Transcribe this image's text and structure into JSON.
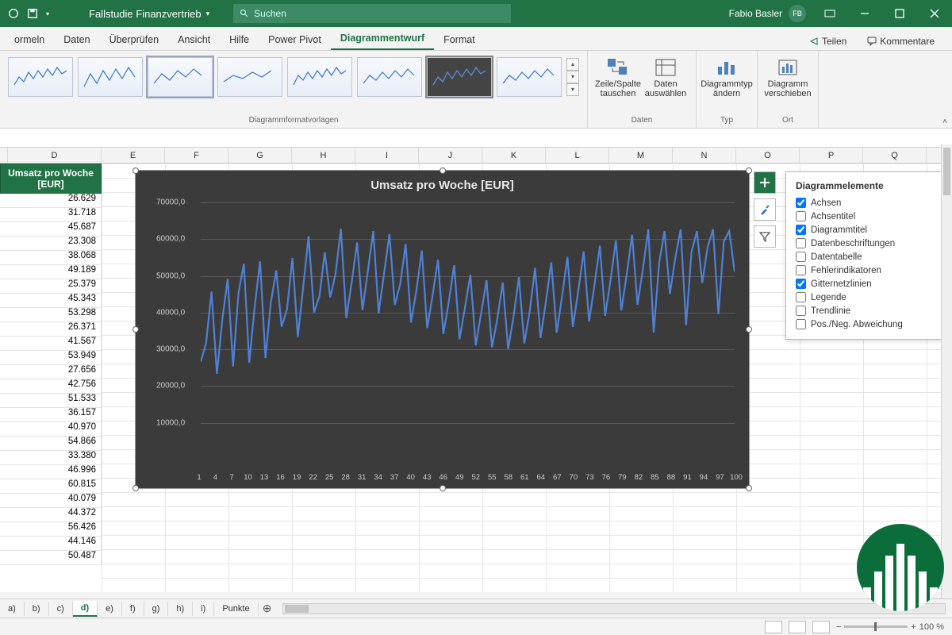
{
  "titlebar": {
    "filename": "Fallstudie Finanzvertrieb",
    "search_placeholder": "Suchen",
    "user_name": "Fabio Basler",
    "user_initials": "FB"
  },
  "ribbon_tabs": [
    "ormeln",
    "Daten",
    "Überprüfen",
    "Ansicht",
    "Hilfe",
    "Power Pivot",
    "Diagrammentwurf",
    "Format"
  ],
  "ribbon_active_tab": "Diagrammentwurf",
  "ribbon_right": {
    "share": "Teilen",
    "comments": "Kommentare"
  },
  "ribbon_groups": {
    "styles": "Diagrammformatvorlagen",
    "data": "Daten",
    "type": "Typ",
    "location": "Ort",
    "btn_switch": "Zeile/Spalte tauschen",
    "btn_select": "Daten auswählen",
    "btn_change": "Diagrammtyp ändern",
    "btn_move": "Diagramm verschieben"
  },
  "columns": [
    "D",
    "E",
    "F",
    "G",
    "H",
    "I",
    "J",
    "K",
    "L",
    "M",
    "N",
    "O",
    "P",
    "Q"
  ],
  "data_header": "Umsatz pro Woche [EUR]",
  "data_values": [
    "26.629",
    "31.718",
    "45.687",
    "23.308",
    "38.068",
    "49.189",
    "25.379",
    "45.343",
    "53.298",
    "26.371",
    "41.567",
    "53.949",
    "27.656",
    "42.756",
    "51.533",
    "36.157",
    "40.970",
    "54.866",
    "33.380",
    "46.996",
    "60.815",
    "40.079",
    "44.372",
    "56.426",
    "44.146",
    "50.487"
  ],
  "chart_side_buttons": [
    "plus",
    "brush",
    "funnel"
  ],
  "flyout": {
    "title": "Diagrammelemente",
    "items": [
      {
        "label": "Achsen",
        "checked": true
      },
      {
        "label": "Achsentitel",
        "checked": false
      },
      {
        "label": "Diagrammtitel",
        "checked": true
      },
      {
        "label": "Datenbeschriftungen",
        "checked": false
      },
      {
        "label": "Datentabelle",
        "checked": false
      },
      {
        "label": "Fehlerindikatoren",
        "checked": false
      },
      {
        "label": "Gitternetzlinien",
        "checked": true
      },
      {
        "label": "Legende",
        "checked": false
      },
      {
        "label": "Trendlinie",
        "checked": false
      },
      {
        "label": "Pos./Neg. Abweichung",
        "checked": false
      }
    ]
  },
  "sheet_tabs": [
    "a)",
    "b)",
    "c)",
    "d)",
    "e)",
    "f)",
    "g)",
    "h)",
    "i)",
    "Punkte"
  ],
  "sheet_active": "d)",
  "status": {
    "zoom": "100 %"
  },
  "chart_data": {
    "type": "line",
    "title": "Umsatz pro Woche [EUR]",
    "xlabel": "",
    "ylabel": "",
    "ylim": [
      0,
      70000
    ],
    "yticks": [
      "10000,0",
      "20000,0",
      "30000,0",
      "40000,0",
      "50000,0",
      "60000,0",
      "70000,0"
    ],
    "xticks": [
      1,
      4,
      7,
      10,
      13,
      16,
      19,
      22,
      25,
      28,
      31,
      34,
      37,
      40,
      43,
      46,
      49,
      52,
      55,
      58,
      61,
      64,
      67,
      70,
      73,
      76,
      79,
      82,
      85,
      88,
      91,
      94,
      97,
      100
    ],
    "x": [
      1,
      2,
      3,
      4,
      5,
      6,
      7,
      8,
      9,
      10,
      11,
      12,
      13,
      14,
      15,
      16,
      17,
      18,
      19,
      20,
      21,
      22,
      23,
      24,
      25,
      26,
      27,
      28,
      29,
      30,
      31,
      32,
      33,
      34,
      35,
      36,
      37,
      38,
      39,
      40,
      41,
      42,
      43,
      44,
      45,
      46,
      47,
      48,
      49,
      50,
      51,
      52,
      53,
      54,
      55,
      56,
      57,
      58,
      59,
      60,
      61,
      62,
      63,
      64,
      65,
      66,
      67,
      68,
      69,
      70,
      71,
      72,
      73,
      74,
      75,
      76,
      77,
      78,
      79,
      80,
      81,
      82,
      83,
      84,
      85,
      86,
      87,
      88,
      89,
      90,
      91,
      92,
      93,
      94,
      95,
      96,
      97,
      98,
      99,
      100
    ],
    "values": [
      26629,
      31718,
      45687,
      23308,
      38068,
      49189,
      25379,
      45343,
      53298,
      26371,
      41567,
      53949,
      27656,
      42756,
      51533,
      36157,
      40970,
      54866,
      33380,
      46996,
      60815,
      40079,
      44372,
      56426,
      44146,
      50487,
      62800,
      38500,
      48200,
      59100,
      40700,
      51300,
      62200,
      39900,
      50600,
      61400,
      42100,
      47800,
      58700,
      37300,
      46100,
      56900,
      35800,
      44700,
      54400,
      34200,
      43000,
      52900,
      32700,
      41400,
      50300,
      31100,
      39900,
      48800,
      30600,
      38400,
      48200,
      30100,
      38900,
      49700,
      31600,
      40400,
      52200,
      33100,
      42900,
      53700,
      34600,
      44400,
      55200,
      36100,
      45900,
      56700,
      37600,
      47400,
      58200,
      39100,
      48900,
      59700,
      40600,
      50400,
      61200,
      42100,
      51900,
      62700,
      34600,
      53400,
      62200,
      45100,
      54900,
      62700,
      36600,
      56400,
      62200,
      48100,
      57900,
      62700,
      39600,
      59400,
      62200,
      51100
    ]
  }
}
